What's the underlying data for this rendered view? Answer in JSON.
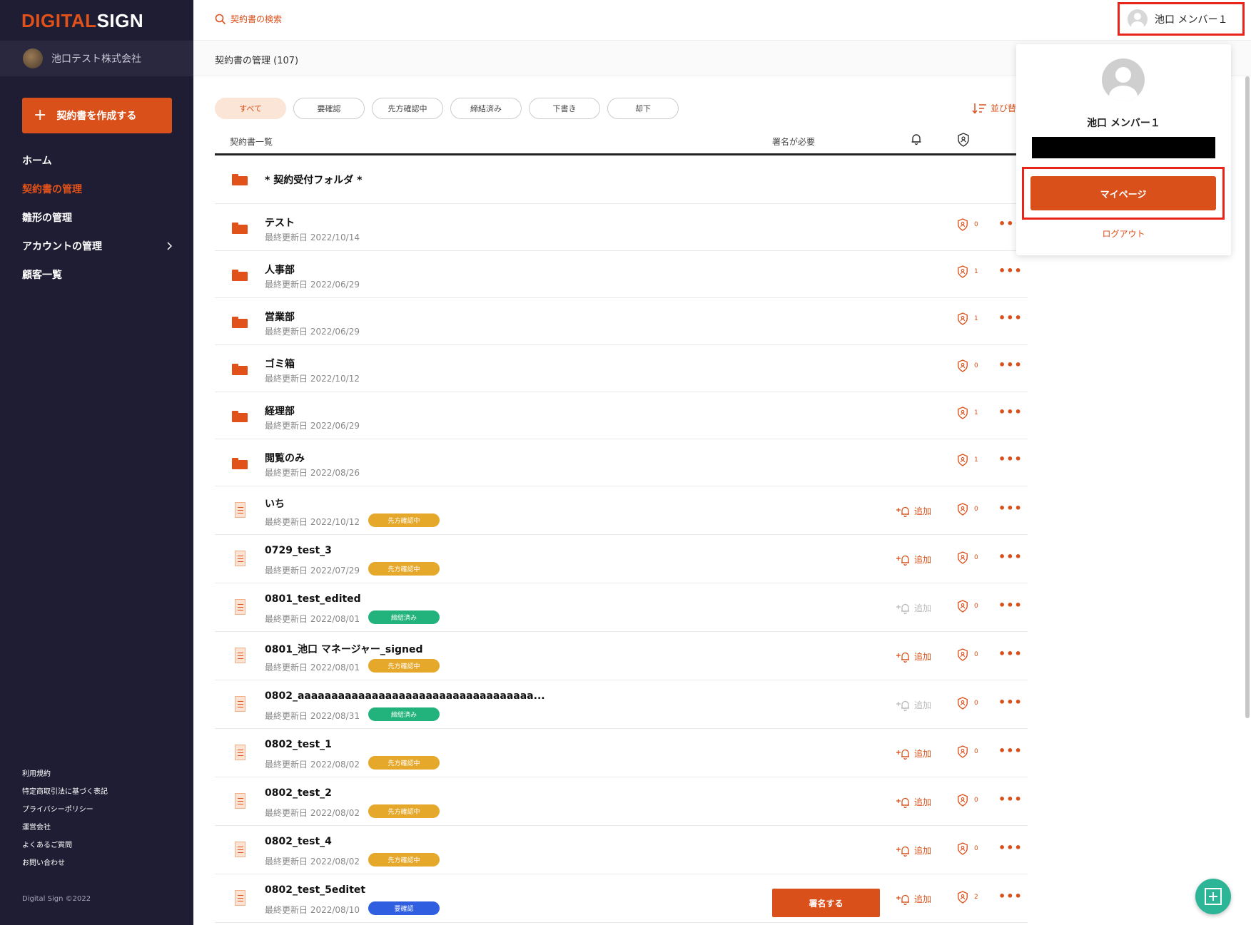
{
  "brand": {
    "logo_part1": "DIGITAL",
    "logo_part2": "SIGN",
    "accent": "#d9501a",
    "sidebar_bg": "#1f1d33"
  },
  "sidebar": {
    "company": "池口テスト株式会社",
    "create_button": "契約書を作成する",
    "items": [
      {
        "label": "ホーム",
        "active": false
      },
      {
        "label": "契約書の管理",
        "active": true
      },
      {
        "label": "雛形の管理",
        "active": false
      },
      {
        "label": "アカウントの管理",
        "active": false,
        "chevron": "chevron-right-icon"
      },
      {
        "label": "顧客一覧",
        "active": false
      }
    ],
    "footer_links": [
      "利用規約",
      "特定商取引法に基づく表記",
      "プライバシーポリシー",
      "運営会社",
      "よくあるご質問",
      "お問い合わせ"
    ],
    "copyright": "Digital Sign ©2022"
  },
  "topbar": {
    "search_label": "契約書の検索",
    "user_name": "池口 メンバー１"
  },
  "subheader": {
    "title": "契約書の管理 (107)"
  },
  "tabs": [
    "すべて",
    "要確認",
    "先方確認中",
    "締結済み",
    "下書き",
    "却下"
  ],
  "sort_label": "並び替",
  "table": {
    "col_name": "契約書一覧",
    "col_sign": "署名が必要",
    "add_label": "追加",
    "sign_button": "署名する",
    "folders": [
      {
        "name": "* 契約受付フォルダ *",
        "date": "",
        "count": ""
      },
      {
        "name": "テスト",
        "date": "最終更新日 2022/10/14",
        "count": "0"
      },
      {
        "name": "人事部",
        "date": "最終更新日 2022/06/29",
        "count": "1"
      },
      {
        "name": "営業部",
        "date": "最終更新日 2022/06/29",
        "count": "1"
      },
      {
        "name": "ゴミ箱",
        "date": "最終更新日 2022/10/12",
        "count": "0"
      },
      {
        "name": "経理部",
        "date": "最終更新日 2022/06/29",
        "count": "1"
      },
      {
        "name": "閲覧のみ",
        "date": "最終更新日 2022/08/26",
        "count": "1"
      }
    ],
    "docs": [
      {
        "name": "いち",
        "date": "最終更新日 2022/10/12",
        "badge": "先方確認中",
        "badge_color": "#e5a82a",
        "count": "0",
        "add_muted": false,
        "sign": false
      },
      {
        "name": "0729_test_3",
        "date": "最終更新日 2022/07/29",
        "badge": "先方確認中",
        "badge_color": "#e5a82a",
        "count": "0",
        "add_muted": false,
        "sign": false
      },
      {
        "name": "0801_test_edited",
        "date": "最終更新日 2022/08/01",
        "badge": "締結済み",
        "badge_color": "#22b27c",
        "count": "0",
        "add_muted": true,
        "sign": false
      },
      {
        "name": "0801_池口 マネージャー_signed",
        "date": "最終更新日 2022/08/01",
        "badge": "先方確認中",
        "badge_color": "#e5a82a",
        "count": "0",
        "add_muted": false,
        "sign": false
      },
      {
        "name": "0802_aaaaaaaaaaaaaaaaaaaaaaaaaaaaaaaaaaa...",
        "date": "最終更新日 2022/08/31",
        "badge": "締結済み",
        "badge_color": "#22b27c",
        "count": "0",
        "add_muted": true,
        "sign": false
      },
      {
        "name": "0802_test_1",
        "date": "最終更新日 2022/08/02",
        "badge": "先方確認中",
        "badge_color": "#e5a82a",
        "count": "0",
        "add_muted": false,
        "sign": false
      },
      {
        "name": "0802_test_2",
        "date": "最終更新日 2022/08/02",
        "badge": "先方確認中",
        "badge_color": "#e5a82a",
        "count": "0",
        "add_muted": false,
        "sign": false
      },
      {
        "name": "0802_test_4",
        "date": "最終更新日 2022/08/02",
        "badge": "先方確認中",
        "badge_color": "#e5a82a",
        "count": "0",
        "add_muted": false,
        "sign": false
      },
      {
        "name": "0802_test_5editet",
        "date": "最終更新日 2022/08/10",
        "badge": "要確認",
        "badge_color": "#2f5fe0",
        "count": "2",
        "add_muted": false,
        "sign": true
      }
    ]
  },
  "popup": {
    "name": "池口 メンバー１",
    "mypage_button": "マイページ",
    "logout": "ログアウト"
  }
}
